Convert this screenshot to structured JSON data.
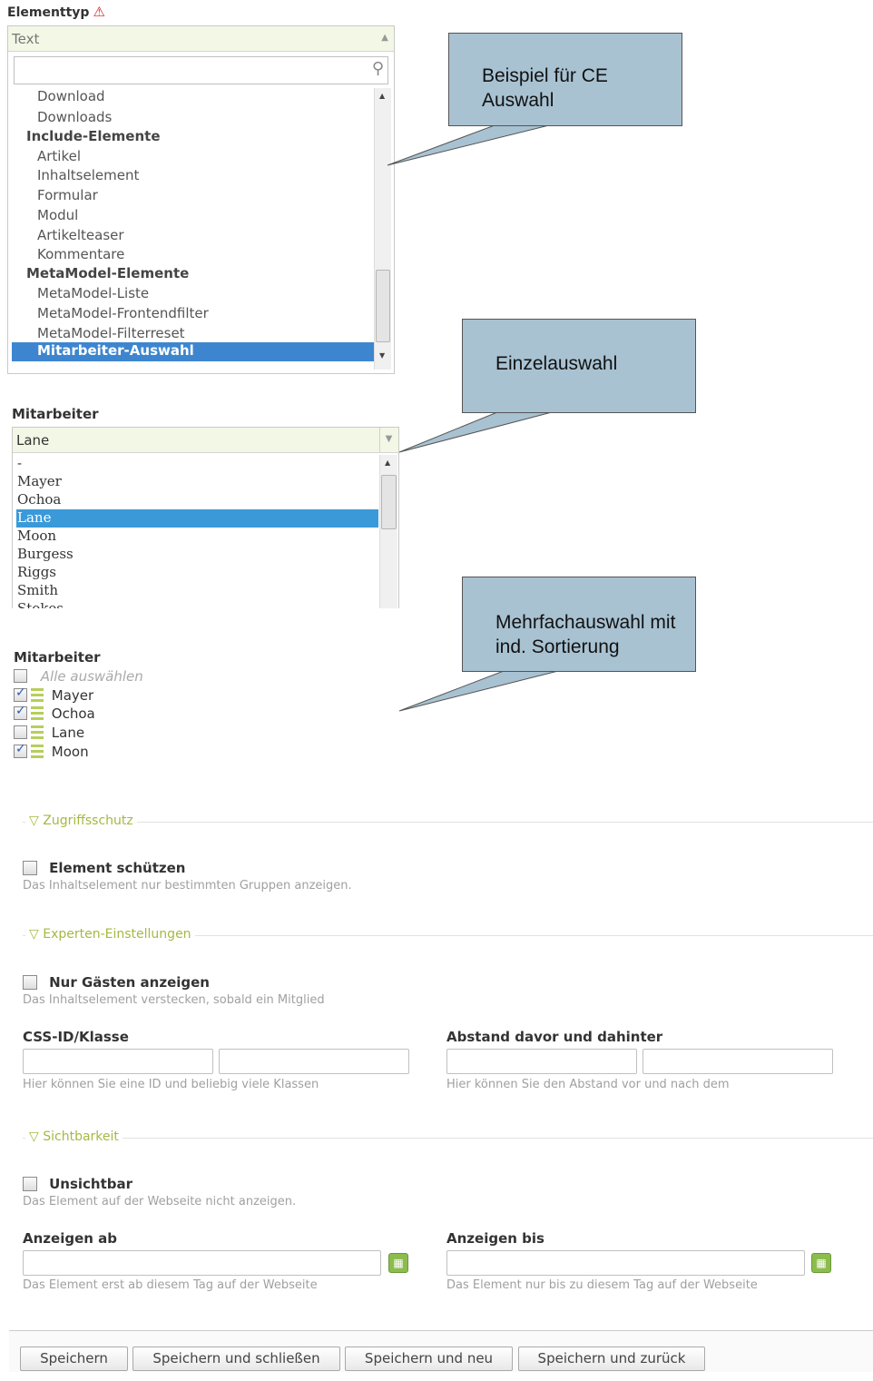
{
  "element_type": {
    "label": "Elementtyp",
    "selected_value": "Text",
    "search_placeholder": "",
    "items": [
      {
        "label": "Download",
        "kind": "item"
      },
      {
        "label": "Downloads",
        "kind": "item"
      },
      {
        "label": "Include-Elemente",
        "kind": "group"
      },
      {
        "label": "Artikel",
        "kind": "item"
      },
      {
        "label": "Inhaltselement",
        "kind": "item"
      },
      {
        "label": "Formular",
        "kind": "item"
      },
      {
        "label": "Modul",
        "kind": "item"
      },
      {
        "label": "Artikelteaser",
        "kind": "item"
      },
      {
        "label": "Kommentare",
        "kind": "item"
      },
      {
        "label": "MetaModel-Elemente",
        "kind": "group"
      },
      {
        "label": "MetaModel-Liste",
        "kind": "item"
      },
      {
        "label": "MetaModel-Frontendfilter",
        "kind": "item"
      },
      {
        "label": "MetaModel-Filterreset",
        "kind": "item"
      },
      {
        "label": "Mitarbeiter-Auswahl",
        "kind": "active"
      }
    ]
  },
  "callouts": {
    "ce": "Beispiel für CE Auswahl",
    "single": "Einzelauswahl",
    "multi": "Mehrfachauswahl mit ind. Sortierung"
  },
  "single_select": {
    "label": "Mitarbeiter",
    "selected_value": "Lane",
    "options": [
      "-",
      "Mayer",
      "Ochoa",
      "Lane",
      "Moon",
      "Burgess",
      "Riggs",
      "Smith",
      "Stokes"
    ],
    "active_option": "Lane"
  },
  "multi_select": {
    "label": "Mitarbeiter",
    "select_all": "Alle auswählen",
    "options": [
      {
        "label": "Mayer",
        "checked": true
      },
      {
        "label": "Ochoa",
        "checked": true
      },
      {
        "label": "Lane",
        "checked": false
      },
      {
        "label": "Moon",
        "checked": true
      }
    ]
  },
  "zugriffsschutz": {
    "legend": "Zugriffsschutz",
    "checkbox_label": "Element schützen",
    "hint": "Das Inhaltselement nur bestimmten Gruppen anzeigen."
  },
  "experten": {
    "legend": "Experten-Einstellungen",
    "checkbox_label": "Nur Gästen anzeigen",
    "checkbox_hint": "Das Inhaltselement verstecken, sobald ein Mitglied",
    "css_label": "CSS-ID/Klasse",
    "css_hint": "Hier können Sie eine ID und beliebig viele Klassen",
    "spacing_label": "Abstand davor und dahinter",
    "spacing_hint": "Hier können Sie den Abstand vor und nach dem"
  },
  "sichtbarkeit": {
    "legend": "Sichtbarkeit",
    "checkbox_label": "Unsichtbar",
    "checkbox_hint": "Das Element auf der Webseite nicht anzeigen.",
    "start_label": "Anzeigen ab",
    "start_hint": "Das Element erst ab diesem Tag auf der Webseite",
    "stop_label": "Anzeigen bis",
    "stop_hint": "Das Element nur bis zu diesem Tag auf der Webseite"
  },
  "buttons": {
    "save": "Speichern",
    "save_close": "Speichern und schließen",
    "save_new": "Speichern und neu",
    "save_back": "Speichern und zurück"
  },
  "icons": {
    "warning": "warning-icon",
    "search": "search-icon",
    "calendar": "calendar-icon",
    "drag": "drag-handle-icon"
  },
  "colors": {
    "accent_green": "#a4b941",
    "selection_blue": "#3d86cf",
    "callout_fill": "#a8c2d2"
  }
}
